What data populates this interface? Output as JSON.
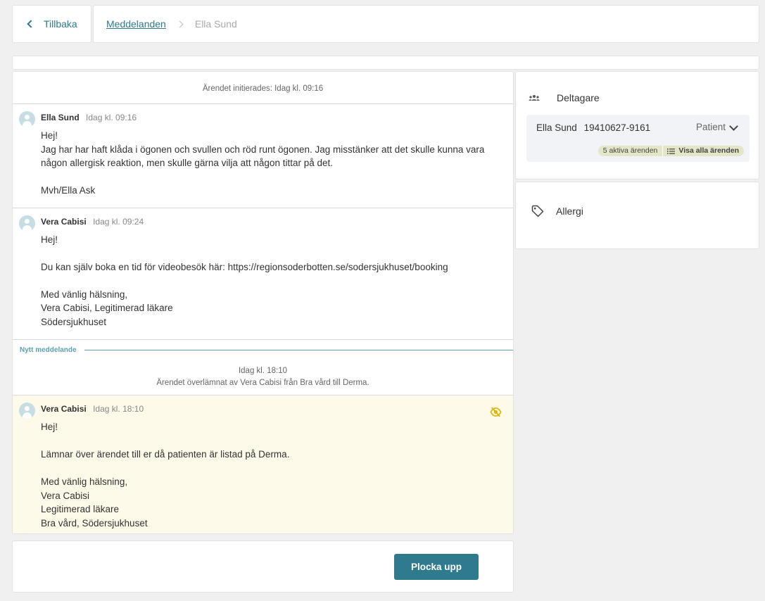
{
  "topbar": {
    "back_label": "Tillbaka",
    "breadcrumb_link": "Meddelanden",
    "breadcrumb_current": "Ella Sund"
  },
  "conversation": {
    "initiated": "Ärendet initierades: Idag kl. 09:16",
    "messages": [
      {
        "author": "Ella Sund",
        "time": "Idag kl. 09:16",
        "body": "Hej!\nJag har har haft klåda i ögonen och svullen och röd runt ögonen. Jag misstänker att det skulle kunna vara någon allergisk reaktion, men skulle gärna vilja att någon tittar på det.\n\nMvh/Ella Ask"
      },
      {
        "author": "Vera Cabisi",
        "time": "Idag kl. 09:24",
        "body": "Hej!\n\nDu kan själv boka en tid för videobesök här: https://regionsoderbotten.se/sodersjukhuset/booking\n\nMed vänlig hälsning,\nVera Cabisi, Legitimerad läkare\nSödersjukhuset"
      }
    ],
    "new_message_label": "Nytt meddelande",
    "handover_time": "Idag kl. 18:10",
    "handover_text": "Ärendet överlämnat av Vera Cabisi från Bra vård till Derma.",
    "new_message": {
      "author": "Vera Cabisi",
      "time": "Idag kl. 18:10",
      "body": "Hej!\n\nLämnar över ärendet till er då patienten är listad på Derma.\n\nMed vänlig hälsning,\nVera Cabisi\nLegitimerad läkare\nBra vård, Södersjukhuset",
      "icon": "eye-off-icon"
    }
  },
  "actions": {
    "pick_up_label": "Plocka upp"
  },
  "participants": {
    "title": "Deltagare",
    "name": "Ella Sund",
    "personal_id": "19410627-9161",
    "role": "Patient",
    "active_cases": "5 aktiva ärenden",
    "show_all": "Visa alla ärenden"
  },
  "tags": {
    "label": "Allergi"
  },
  "colors": {
    "accent": "#2f7a8c",
    "highlight_bg": "#fdfaea",
    "eye_icon": "#e0b400",
    "pill_bg": "#e3e6c7"
  }
}
